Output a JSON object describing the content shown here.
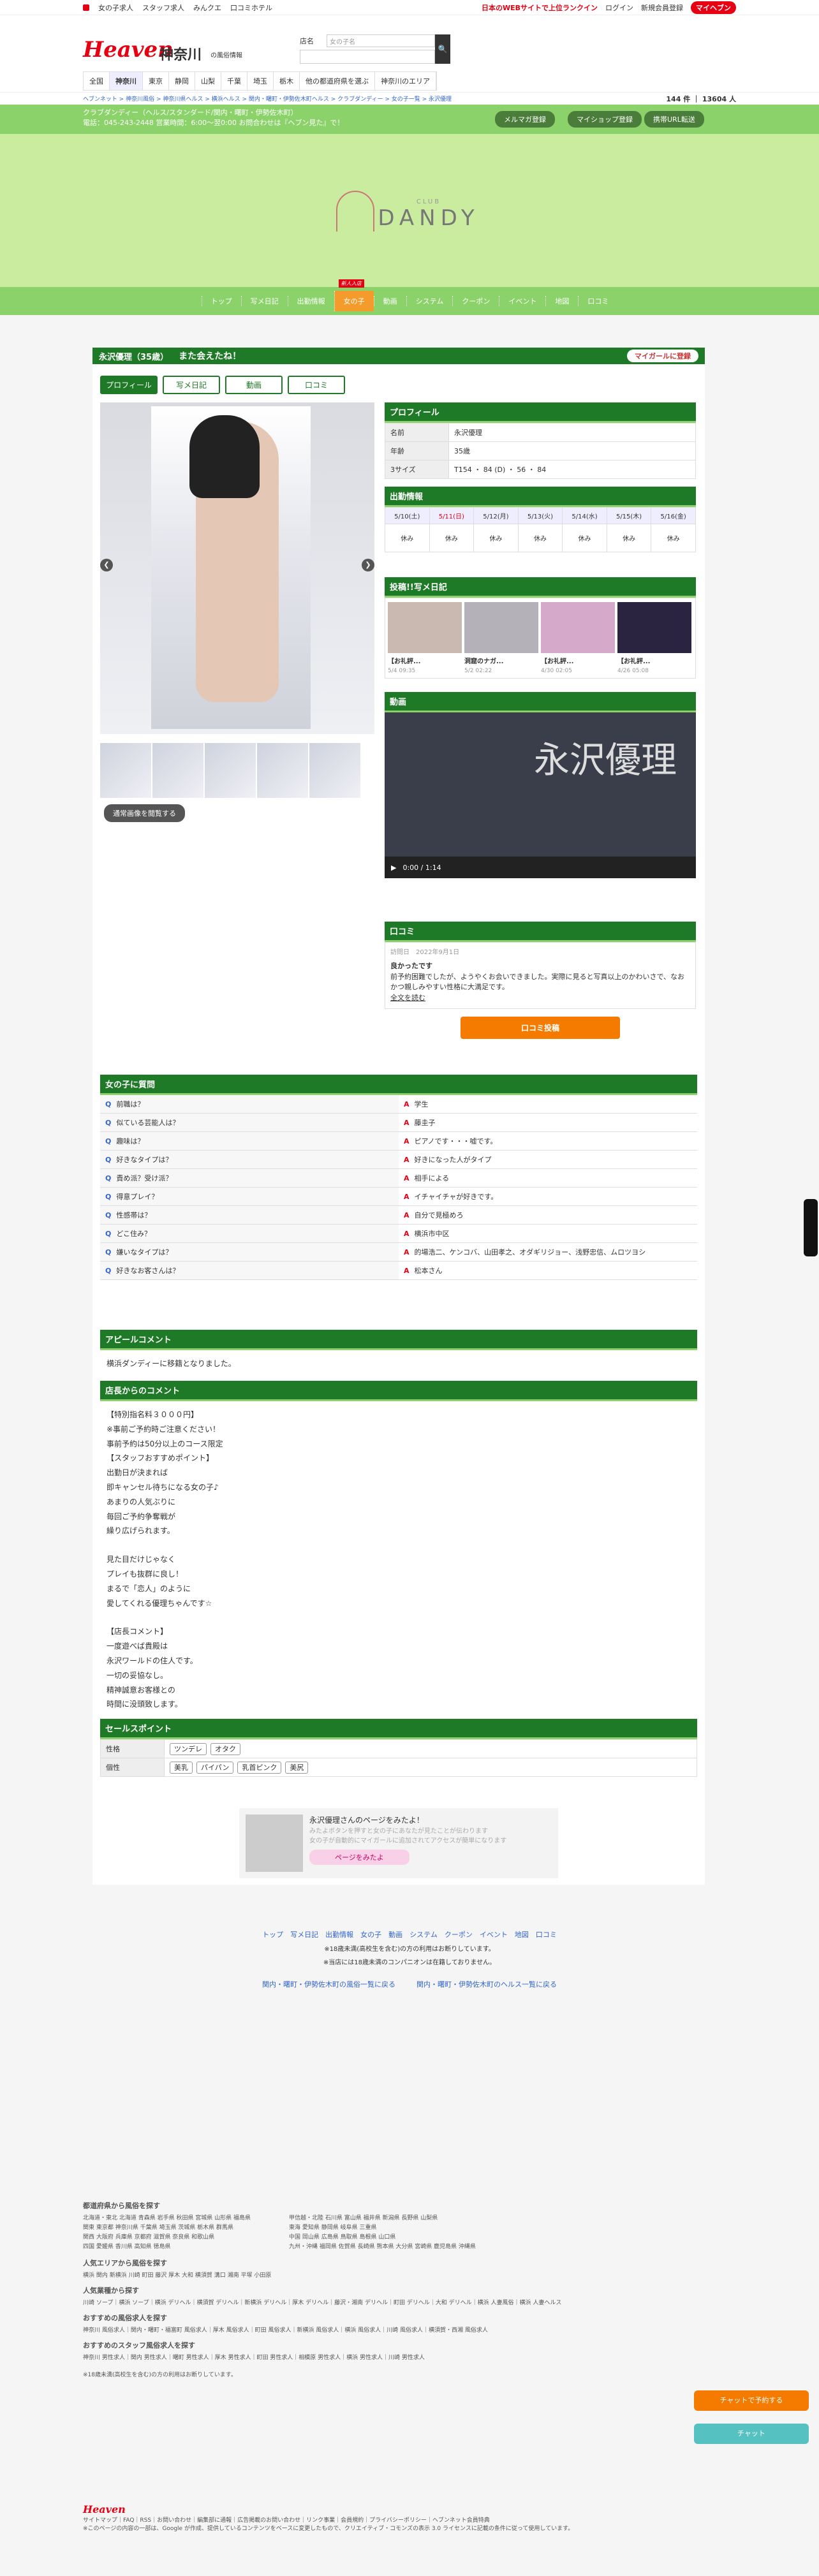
{
  "topnav": {
    "items": [
      "女の子求人",
      "スタッフ求人",
      "みんクエ",
      "口コミホテル"
    ],
    "right": [
      "日本のWEBサイトで上位ランクイン",
      "ログイン",
      "新規会員登録",
      "マイヘブン"
    ]
  },
  "header": {
    "brand": "Heaven",
    "region": "神奈川",
    "region_sub": "の風俗情報",
    "search_label": "店名",
    "search_placeholder": "女の子名"
  },
  "areas": [
    "全国",
    "神奈川",
    "東京",
    "静岡",
    "山梨",
    "千葉",
    "埼玉",
    "栃木",
    "他の都道府県を選ぶ",
    "神奈川のエリア"
  ],
  "crumbs": {
    "path": "ヘブンネット > 神奈川風俗 > 神奈川県ヘルス > 横浜ヘルス > 関内・曙町・伊勢佐木町ヘルス > クラブダンディー > 女の子一覧 > 永沢優理",
    "count_label": "144",
    "count_total": "13604"
  },
  "shop": {
    "line1": "クラブダンディー（ヘルス/スタンダード/関内・曙町・伊勢佐木町）",
    "line2": "電話：045-243-2448 営業時間：6:00～翌0:00 お問合わせは『ヘブン見た』で！",
    "btn_mail": "メルマガ登録",
    "btn_shop": "マイショップ登録",
    "btn_mobile": "携帯URL転送"
  },
  "logo": {
    "club": "CLUB",
    "name": "DANDY"
  },
  "gnav": [
    {
      "label": "トップ"
    },
    {
      "label": "写メ日記"
    },
    {
      "label": "出勤情報"
    },
    {
      "label": "女の子",
      "on": true,
      "badge": "新人入店"
    },
    {
      "label": "動画"
    },
    {
      "label": "システム"
    },
    {
      "label": "クーポン"
    },
    {
      "label": "イベント"
    },
    {
      "label": "地図"
    },
    {
      "label": "口コミ"
    }
  ],
  "girl": {
    "name": "永沢優理（35歳）",
    "message": "また会えたね！",
    "fav": "マイガールに登録",
    "tabs": [
      "プロフィール",
      "写メ日記",
      "動画",
      "口コミ"
    ],
    "big_pic": "通常画像を閲覧する"
  },
  "profile": {
    "title": "プロフィール",
    "rows": [
      {
        "k": "名前",
        "v": "永沢優理"
      },
      {
        "k": "年齢",
        "v": "35歳"
      },
      {
        "k": "3サイズ",
        "v": "T154 ・ 84 (D) ・ 56 ・ 84"
      }
    ]
  },
  "schedule": {
    "title": "出勤情報",
    "days": [
      "5/10(土)",
      "5/11(日)",
      "5/12(月)",
      "5/13(火)",
      "5/14(水)",
      "5/15(木)",
      "5/16(金)"
    ],
    "vals": [
      "休み",
      "休み",
      "休み",
      "休み",
      "休み",
      "休み",
      "休み"
    ]
  },
  "diary": {
    "title": "投稿!!写メ日記",
    "posts": [
      {
        "t": "【お礼評...",
        "d": "5/4 09:35"
      },
      {
        "t": "洞窟のナガ...",
        "d": "5/2 02:22"
      },
      {
        "t": "【お礼評...",
        "d": "4/30 02:05"
      },
      {
        "t": "【お礼評...",
        "d": "4/26 05:08"
      }
    ]
  },
  "video": {
    "title": "動画",
    "name_overlay": "永沢優理",
    "time": "0:00 / 1:14"
  },
  "review": {
    "title": "口コミ",
    "date_label": "訪問日",
    "date": "2022年9月1日",
    "head": "良かったです",
    "body": "前予約困難でしたが、ようやくお会いできました。実際に見ると写真以上のかわいさで、なおかつ親しみやすい性格に大満足です。",
    "more": "全文を読む",
    "btn": "口コミ投稿"
  },
  "qa": {
    "title": "女の子に質問",
    "items": [
      {
        "q": "前職は？",
        "a": "学生"
      },
      {
        "q": "似ている芸能人は？",
        "a": "藤圭子"
      },
      {
        "q": "趣味は？",
        "a": "ピアノです・・・嘘です。"
      },
      {
        "q": "好きなタイプは？",
        "a": "好きになった人がタイプ"
      },
      {
        "q": "責め派？受け派？",
        "a": "相手による"
      },
      {
        "q": "得意プレイ？",
        "a": "イチャイチャが好きです。"
      },
      {
        "q": "性感帯は？",
        "a": "自分で見極めろ"
      },
      {
        "q": "どこ住み？",
        "a": "横浜市中区"
      },
      {
        "q": "嫌いなタイプは？",
        "a": "的場浩二、ケンコバ、山田孝之、オダギリジョー、浅野忠信、ムロツヨシ"
      },
      {
        "q": "好きなお客さんは？",
        "a": "松本さん"
      }
    ]
  },
  "appeal": {
    "title": "アピールコメント",
    "text": "横浜ダンディーに移籍となりました。"
  },
  "staff": {
    "title": "店長からのコメント",
    "lines": [
      "【特別指名料３０００円】",
      "※事前ご予約時ご注意ください！",
      "事前予約は50分以上のコース限定",
      "【スタッフおすすめポイント】",
      "出勤日が決まれば",
      "即キャンセル待ちになる女の子♪",
      "あまりの人気ぶりに",
      "毎回ご予約争奪戦が",
      "繰り広げられます。",
      "",
      "見た目だけじゃなく",
      "プレイも抜群に良し！",
      "まるで「恋人」のように",
      "愛してくれる優理ちゃんです☆",
      "",
      "【店長コメント】",
      "一度遊べば貴殿は",
      "永沢ワールドの住人です。",
      "一切の妥協なし。",
      "精神誠意お客様との",
      "時間に没頭致します。"
    ]
  },
  "points": {
    "title": "セールスポイント",
    "rows": [
      {
        "k": "性格",
        "tags": [
          "ツンデレ",
          "オタク"
        ]
      },
      {
        "k": "個性",
        "tags": [
          "美乳",
          "パイパン",
          "乳首ピンク",
          "美尻"
        ]
      }
    ]
  },
  "share": {
    "title": "永沢優理さんのページをみたよ！",
    "sub1": "みたよボタンを押すと女の子にあなたが見たことが伝わります",
    "sub2": "女の子が自動的にマイガールに追加されてアクセスが簡単になります",
    "btn": "ページをみたよ"
  },
  "fnav": {
    "links": [
      "トップ",
      "写メ日記",
      "出勤情報",
      "女の子",
      "動画",
      "システム",
      "クーポン",
      "イベント",
      "地図",
      "口コミ"
    ],
    "note1": "※18歳未満(高校生を含む)の方の利用はお断りしています。",
    "note2": "※当店には18歳未満のコンパニオンは在籍しておりません。",
    "link1": "関内・曙町・伊勢佐木町の風俗一覧に戻る",
    "link2": "関内・曙町・伊勢佐木町のヘルス一覧に戻る"
  },
  "footer": {
    "h1": "都道府県から風俗を探す",
    "r1": "北海道・東北 北海道 青森県 岩手県 秋田県 宮城県 山形県 福島県",
    "r2": "関東 東京都 神奈川県 千葉県 埼玉県 茨城県 栃木県 群馬県",
    "r3": "関西 大阪府 兵庫県 京都府 滋賀県 奈良県 和歌山県",
    "r4": "四国 愛媛県 香川県 高知県 徳島県",
    "r5": "甲信越・北陸 石川県 富山県 福井県 新潟県 長野県 山梨県",
    "r6": "東海 愛知県 静岡県 岐阜県 三重県",
    "r7": "中国 岡山県 広島県 鳥取県 島根県 山口県",
    "r8": "九州・沖縄 福岡県 佐賀県 長崎県 熊本県 大分県 宮崎県 鹿児島県 沖縄県",
    "h2": "人気エリアから風俗を探す",
    "a2": "横浜 関内 新横浜 川崎 町田 藤沢 厚木 大和 横須賀 溝口 湘南 平塚 小田原",
    "h3": "人気業種から探す",
    "a3": "川崎 ソープ｜横浜 ソープ｜横浜 デリヘル｜横須賀 デリヘル｜新横浜 デリヘル｜厚木 デリヘル｜藤沢・湘南 デリヘル｜町田 デリヘル｜大和 デリヘル｜横浜 人妻風俗｜横浜 人妻ヘルス",
    "h4": "おすすめの風俗求人を探す",
    "a4": "神奈川 風俗求人｜関内・曙町・福富町 風俗求人｜厚木 風俗求人｜町田 風俗求人｜新横浜 風俗求人｜横浜 風俗求人｜川崎 風俗求人｜横須賀・西湘 風俗求人",
    "h5": "おすすめのスタッフ風俗求人を探す",
    "a5": "神奈川 男性求人｜関内 男性求人｜曙町 男性求人｜厚木 男性求人｜町田 男性求人｜相模原 男性求人｜横浜 男性求人｜川崎 男性求人",
    "note": "※18歳未満(高校生を含む)の方の利用はお断りしています。",
    "f1": "サイトマップ｜FAQ｜RSS｜お問い合わせ｜編集部に通報｜広告掲載のお問い合わせ｜リンク事業｜会員規約｜プライバシーポリシー｜ヘブンネット会員特典",
    "f2": "※このページの内容の一部は、Google が作成、提供しているコンテンツをベースに変更したもので、クリエイティブ・コモンズの表示 3.0 ライセンスに記載の条件に従って使用しています。"
  },
  "float": {
    "chat1": "チャットで予約する",
    "chat2": "チャット"
  },
  "colors": {
    "green": "#1e7a26",
    "lightgreen": "#8bd26a",
    "red": "#e60012",
    "orange": "#f47b00"
  }
}
